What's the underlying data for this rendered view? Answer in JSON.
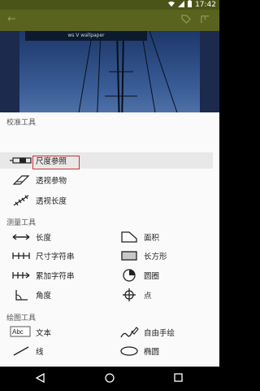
{
  "status": {
    "time": "17:42"
  },
  "photo": {
    "caption": "ws V wallpaper"
  },
  "sections": {
    "calibration": "校准工具",
    "measure": "测量工具",
    "draw": "绘图工具"
  },
  "calibration_items": [
    {
      "label": "尺度参照",
      "icon": "ruler-reference-icon"
    },
    {
      "label": "透视参物",
      "icon": "perspective-object-icon"
    },
    {
      "label": "透视长度",
      "icon": "perspective-length-icon"
    }
  ],
  "measure_items": [
    {
      "label": "长度",
      "icon": "length-icon"
    },
    {
      "label": "面积",
      "icon": "area-icon"
    },
    {
      "label": "尺寸字符串",
      "icon": "dimension-string-icon"
    },
    {
      "label": "长方形",
      "icon": "rectangle-icon"
    },
    {
      "label": "累加字符串",
      "icon": "cumulative-string-icon"
    },
    {
      "label": "圆圈",
      "icon": "circle-measure-icon"
    },
    {
      "label": "角度",
      "icon": "angle-icon"
    },
    {
      "label": "点",
      "icon": "point-icon"
    }
  ],
  "draw_items": [
    {
      "label": "文本",
      "icon": "text-icon",
      "icon_text": "Abc"
    },
    {
      "label": "自由手绘",
      "icon": "freehand-icon"
    },
    {
      "label": "线",
      "icon": "line-icon"
    },
    {
      "label": "椭圆",
      "icon": "ellipse-icon"
    }
  ]
}
